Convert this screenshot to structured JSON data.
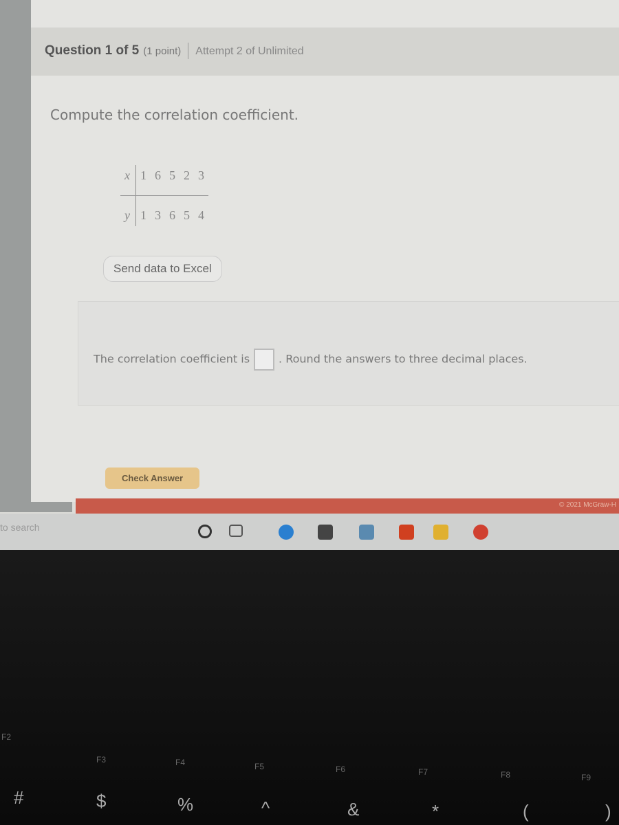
{
  "header": {
    "question": "Question 1 of 5",
    "points": "(1 point)",
    "attempt": "Attempt 2 of Unlimited"
  },
  "prompt": "Compute the correlation coefficient.",
  "table": {
    "x_label": "x",
    "y_label": "y",
    "x": [
      "1",
      "6",
      "5",
      "2",
      "3"
    ],
    "y": [
      "1",
      "3",
      "6",
      "5",
      "4"
    ]
  },
  "excel_button": "Send data to Excel",
  "answer": {
    "prefix": "The correlation coefficient is",
    "value": "",
    "suffix": ". Round the answers to three decimal places."
  },
  "check_button": "Check Answer",
  "copyright": "© 2021 McGraw-H",
  "taskbar": {
    "search": "to search"
  },
  "keys": {
    "f2": "F2",
    "f3": "F3",
    "f4": "F4",
    "f5": "F5",
    "f6": "F6",
    "f7": "F7",
    "f8": "F8",
    "f9": "F9",
    "hash": "#",
    "dollar": "$",
    "percent": "%",
    "caret": "^",
    "amp": "&",
    "star": "*",
    "lparen": "(",
    "rparen": ")"
  }
}
